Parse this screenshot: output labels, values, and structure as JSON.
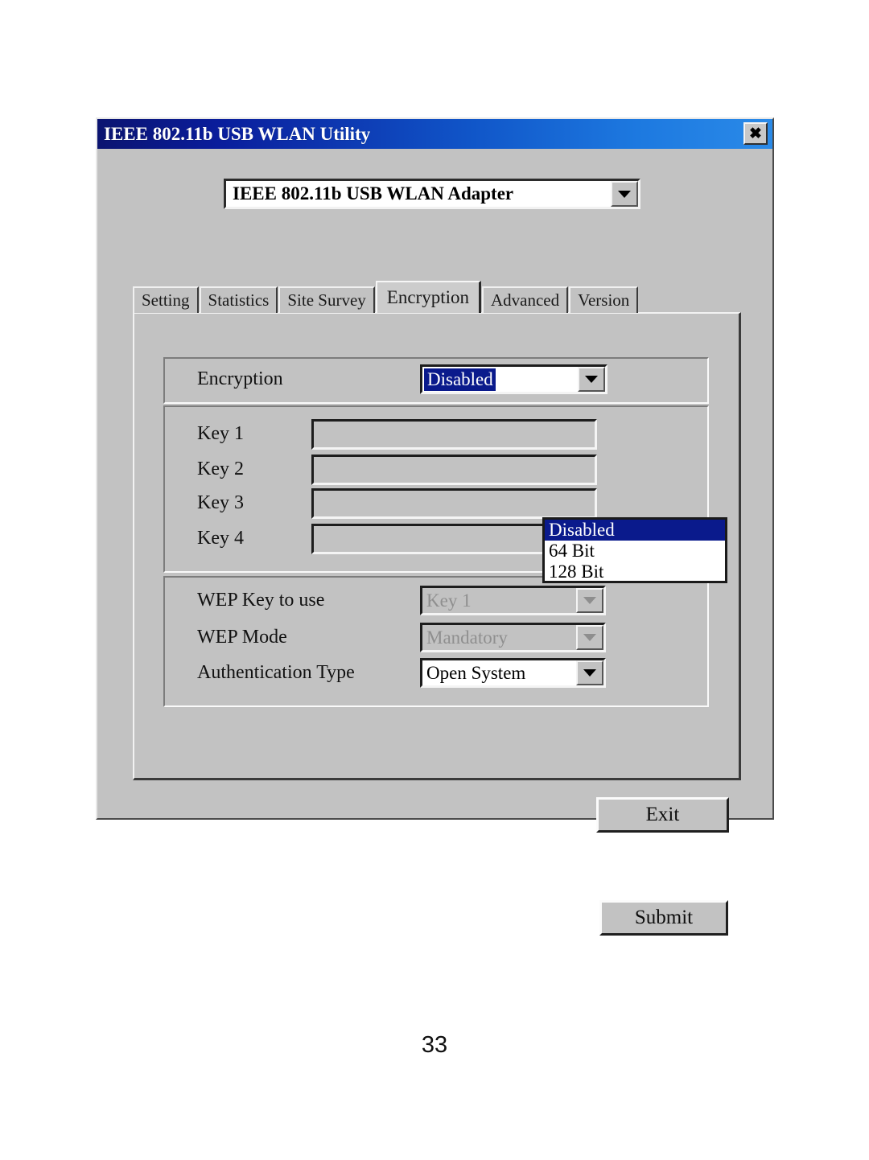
{
  "page": {
    "page_number": "33",
    "background_color": "#ffffff"
  },
  "window": {
    "title": "IEEE 802.11b USB WLAN Utility",
    "close_icon": "close-x-icon",
    "titlebar_color_left": "#0b1470",
    "titlebar_color_right": "#2a8ae8",
    "face_color": "#c2c2c2"
  },
  "adapter_select": {
    "value": "IEEE 802.11b USB WLAN Adapter",
    "arrow_icon": "chevron-down-icon"
  },
  "tabs": [
    {
      "label": "Setting",
      "active": false
    },
    {
      "label": "Statistics",
      "active": false
    },
    {
      "label": "Site Survey",
      "active": false
    },
    {
      "label": "Encryption",
      "active": true
    },
    {
      "label": "Advanced",
      "active": false
    },
    {
      "label": "Version",
      "active": false
    }
  ],
  "encryption_group": {
    "label": "Encryption",
    "value": "Disabled",
    "arrow_icon": "chevron-down-icon",
    "open": true,
    "highlight_color": "#0a1a8c",
    "options": [
      {
        "label": "Disabled",
        "selected": true
      },
      {
        "label": "64 Bit",
        "selected": false
      },
      {
        "label": "128 Bit",
        "selected": false
      }
    ]
  },
  "keys_group": {
    "rows": [
      {
        "label": "Key 1",
        "value": "",
        "disabled": true
      },
      {
        "label": "Key 2",
        "value": "",
        "disabled": true
      },
      {
        "label": "Key 3",
        "value": "",
        "disabled": true
      },
      {
        "label": "Key 4",
        "value": "",
        "disabled": true
      }
    ]
  },
  "wep_group": {
    "wep_key_to_use": {
      "label": "WEP Key to use",
      "value": "Key 1",
      "disabled": true,
      "arrow_icon": "chevron-down-icon"
    },
    "wep_mode": {
      "label": "WEP Mode",
      "value": "Mandatory",
      "disabled": true,
      "arrow_icon": "chevron-down-icon"
    },
    "authentication_type": {
      "label": "Authentication Type",
      "value": "Open System",
      "disabled": false,
      "arrow_icon": "chevron-down-icon"
    }
  },
  "buttons": {
    "submit": "Submit",
    "exit": "Exit"
  }
}
